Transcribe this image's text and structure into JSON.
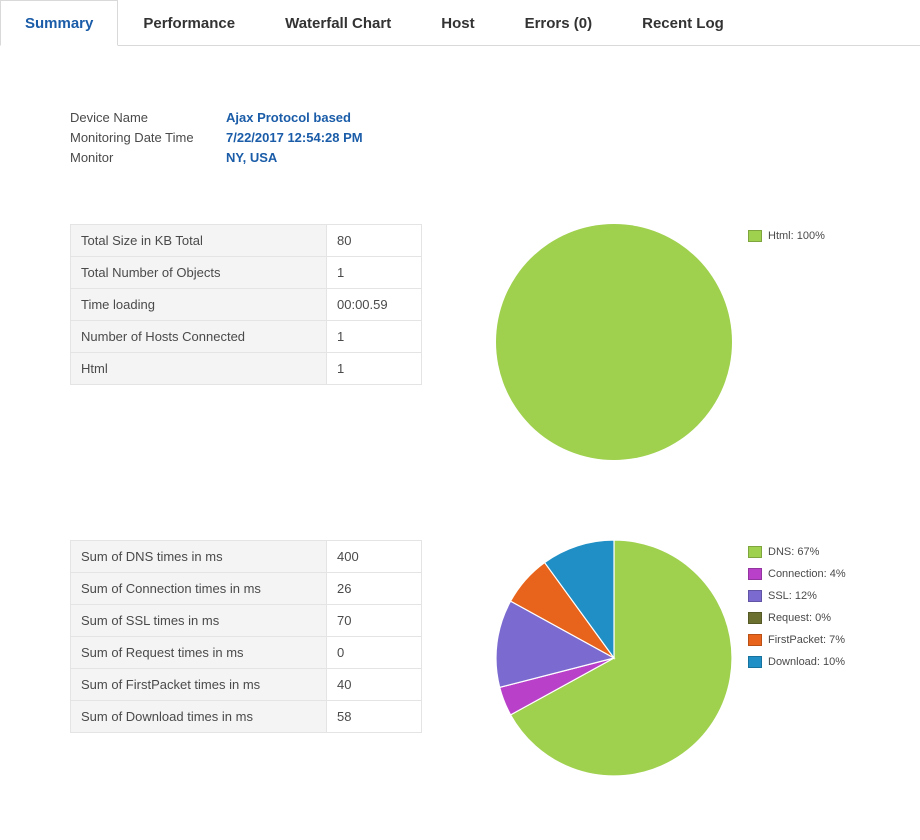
{
  "tabs": {
    "summary": "Summary",
    "performance": "Performance",
    "waterfall": "Waterfall Chart",
    "host": "Host",
    "errors": "Errors (0)",
    "recentlog": "Recent Log"
  },
  "meta": {
    "device_label": "Device Name",
    "device_value": "Ajax Protocol based",
    "datetime_label": "Monitoring Date Time",
    "datetime_value": "7/22/2017 12:54:28 PM",
    "monitor_label": "Monitor",
    "monitor_value": "NY, USA"
  },
  "totals": {
    "rows": [
      {
        "k": "Total Size in KB Total",
        "v": "80"
      },
      {
        "k": "Total Number of Objects",
        "v": "1"
      },
      {
        "k": "Time loading",
        "v": "00:00.59"
      },
      {
        "k": "Number of Hosts Connected",
        "v": "1"
      },
      {
        "k": "Html",
        "v": "1"
      }
    ]
  },
  "timings": {
    "rows": [
      {
        "k": "Sum of DNS times in ms",
        "v": "400"
      },
      {
        "k": "Sum of Connection times in ms",
        "v": "26"
      },
      {
        "k": "Sum of SSL times in ms",
        "v": "70"
      },
      {
        "k": "Sum of Request times in ms",
        "v": "0"
      },
      {
        "k": "Sum of FirstPacket times in ms",
        "v": "40"
      },
      {
        "k": "Sum of Download times in ms",
        "v": "58"
      }
    ]
  },
  "chart_data": [
    {
      "type": "pie",
      "title": "",
      "series": [
        {
          "name": "Html",
          "value": 100,
          "color": "#9fd04e",
          "label": "Html: 100%"
        }
      ]
    },
    {
      "type": "pie",
      "title": "",
      "series": [
        {
          "name": "DNS",
          "value": 67,
          "color": "#9fd04e",
          "label": "DNS: 67%"
        },
        {
          "name": "Connection",
          "value": 4,
          "color": "#b941c9",
          "label": "Connection: 4%"
        },
        {
          "name": "SSL",
          "value": 12,
          "color": "#7b6bd0",
          "label": "SSL: 12%"
        },
        {
          "name": "Request",
          "value": 0,
          "color": "#6b7030",
          "label": "Request: 0%"
        },
        {
          "name": "FirstPacket",
          "value": 7,
          "color": "#e8641c",
          "label": "FirstPacket: 7%"
        },
        {
          "name": "Download",
          "value": 10,
          "color": "#1f8fc6",
          "label": "Download: 10%"
        }
      ]
    }
  ]
}
